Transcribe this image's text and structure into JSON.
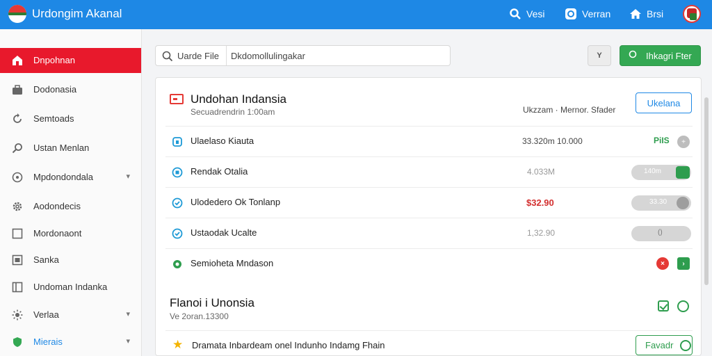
{
  "header": {
    "app_title": "Urdongim Akanal",
    "search_label": "Vesi",
    "second_label": "Verran",
    "home_label": "Brsi"
  },
  "sidebar": {
    "items": [
      {
        "label": "Dnpohnan",
        "icon": "home-icon",
        "active": true
      },
      {
        "label": "Dodonasia",
        "icon": "briefcase-icon"
      },
      {
        "label": "Semtoads",
        "icon": "refresh-icon"
      },
      {
        "label": "Ustan Menlan",
        "icon": "search-icon"
      },
      {
        "label": "Mpdondondala",
        "icon": "clock-icon",
        "chevron": "▾"
      },
      {
        "label": "Aodondecis",
        "icon": "gear-icon"
      },
      {
        "label": "Mordonaont",
        "icon": "square-icon"
      },
      {
        "label": "Sanka",
        "icon": "window-icon"
      },
      {
        "label": "Undoman Indanka",
        "icon": "columns-icon"
      },
      {
        "label": "Verlaa",
        "icon": "sun-icon",
        "chevron": "▾"
      },
      {
        "label": "Mierais",
        "icon": "shield-icon",
        "chevron": "▾"
      }
    ]
  },
  "toolbar": {
    "search_label": "Uarde File",
    "search_value": "Dkdomollulingakar",
    "filter_label": "Y",
    "green_button_label": "Ihkagri Fter"
  },
  "card": {
    "title": "Undohan Indansia",
    "subtitle": "Secuadrendrin 1:00am",
    "meta": "Ukzzam · Mernor. Sfader",
    "button_label": "Ukelana",
    "rows": [
      {
        "label": "Ulaelaso Kiauta",
        "value": "33.320m   10.000",
        "tag": "PiIS"
      },
      {
        "label": "Rendak Otalia",
        "value": "4.033M",
        "toggle_text": "140m"
      },
      {
        "label": "Ulodedero Ok Tonlanp",
        "value": "$32.90",
        "toggle_text": "33.30"
      },
      {
        "label": "Ustaodak Ucalte",
        "value": "1,32.90",
        "toggle_text": "()"
      },
      {
        "label": "Semioheta Mndason"
      }
    ]
  },
  "section": {
    "title": "Flanoi i Unonsia",
    "subtitle": "Ve 2oran.13300",
    "row_label": "Dramata Inbardeam onel Indunho Indamg Fhain",
    "button_label": "Favadr"
  }
}
